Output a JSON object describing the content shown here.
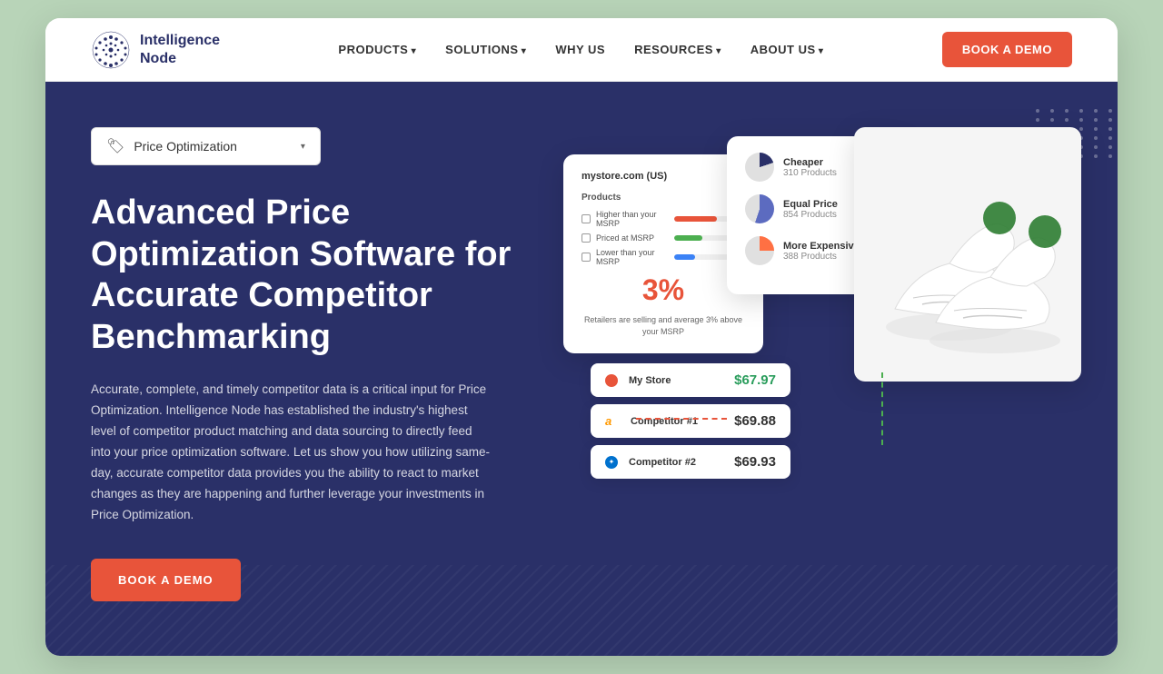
{
  "nav": {
    "logo_line1": "Intelligence",
    "logo_line2": "Node",
    "links": [
      {
        "label": "PRODUCTS",
        "has_dropdown": true
      },
      {
        "label": "SOLUTIONS",
        "has_dropdown": true
      },
      {
        "label": "WHY US",
        "has_dropdown": false
      },
      {
        "label": "RESOURCES",
        "has_dropdown": true
      },
      {
        "label": "ABOUT US",
        "has_dropdown": true
      }
    ],
    "cta_label": "BOOK A DEMO"
  },
  "hero": {
    "selector_label": "Price Optimization",
    "title": "Advanced Price Optimization Software for Accurate Competitor Benchmarking",
    "description": "Accurate, complete, and timely competitor data is a critical input for Price Optimization. Intelligence Node has established the industry's highest level of competitor product matching and data sourcing to directly feed into your price optimization software. Let us show you how utilizing same-day, accurate competitor data provides you the ability to react to market changes as they are happening and further leverage your investments in Price Optimization.",
    "cta_label": "BOOK A DEMO"
  },
  "dashboard": {
    "store_card": {
      "title": "mystore.com (US)",
      "subtitle": "Products",
      "percentage": "3%",
      "percentage_desc": "Retailers are selling and average 3% above your MSRP",
      "rows": [
        {
          "label": "Higher than your MSRP",
          "bar_type": "red"
        },
        {
          "label": "Priced at MSRP",
          "bar_type": "green"
        },
        {
          "label": "Lower than your MSRP",
          "bar_type": "blue"
        }
      ]
    },
    "pie_items": [
      {
        "label": "Cheaper",
        "count": "310 Products",
        "type": "cheaper"
      },
      {
        "label": "Equal Price",
        "count": "854 Products",
        "type": "equal"
      },
      {
        "label": "More Expensive",
        "count": "388 Products",
        "type": "expensive"
      }
    ],
    "prices": [
      {
        "store": "My Store",
        "price": "$67.97",
        "type": "mystore"
      },
      {
        "store": "Competitor #1",
        "price": "$69.88",
        "type": "amazon"
      },
      {
        "store": "Competitor #2",
        "price": "$69.93",
        "type": "walmart"
      }
    ]
  }
}
